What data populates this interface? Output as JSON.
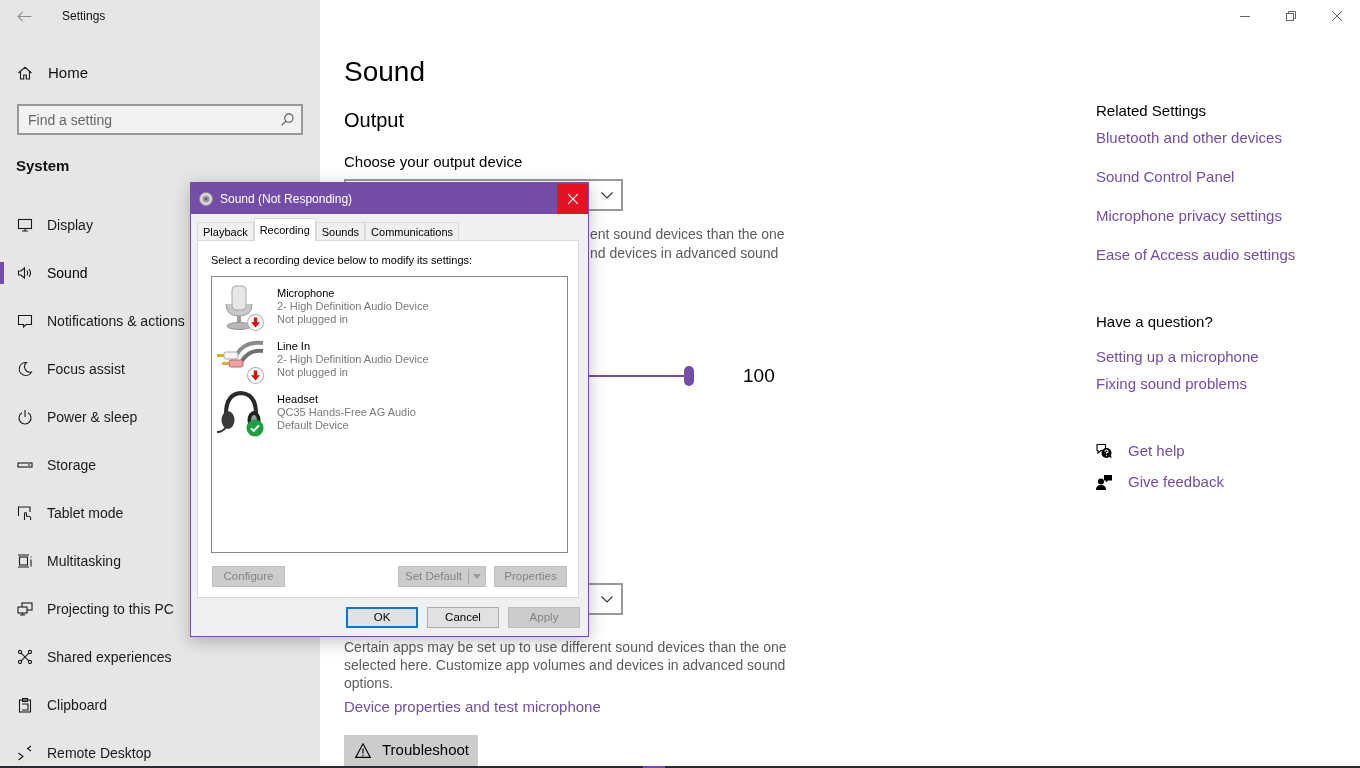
{
  "window": {
    "title": "Settings"
  },
  "sidebar": {
    "home": "Home",
    "search": {
      "placeholder": "Find a setting"
    },
    "section": "System",
    "items": [
      {
        "label": "Display",
        "selected": false
      },
      {
        "label": "Sound",
        "selected": true
      },
      {
        "label": "Notifications & actions",
        "selected": false
      },
      {
        "label": "Focus assist",
        "selected": false
      },
      {
        "label": "Power & sleep",
        "selected": false
      },
      {
        "label": "Storage",
        "selected": false
      },
      {
        "label": "Tablet mode",
        "selected": false
      },
      {
        "label": "Multitasking",
        "selected": false
      },
      {
        "label": "Projecting to this PC",
        "selected": false
      },
      {
        "label": "Shared experiences",
        "selected": false
      },
      {
        "label": "Clipboard",
        "selected": false
      },
      {
        "label": "Remote Desktop",
        "selected": false
      }
    ]
  },
  "page": {
    "title": "Sound",
    "output": {
      "heading": "Output",
      "device_label": "Choose your output device",
      "note_fragments": [
        "ent sound devices than the one",
        "nd devices in advanced sound"
      ],
      "volume": {
        "level": 1,
        "reading": "100"
      }
    },
    "input": {
      "note": "Certain apps may be set up to use different sound devices than the one selected here. Customize app volumes and devices in advanced sound options.",
      "link": "Device properties and test microphone",
      "troubleshoot": "Troubleshoot"
    }
  },
  "related_settings": {
    "heading": "Related Settings",
    "links": [
      "Bluetooth and other devices",
      "Sound Control Panel",
      "Microphone privacy settings",
      "Ease of Access audio settings"
    ]
  },
  "questions": {
    "heading": "Have a question?",
    "links": [
      "Setting up a microphone",
      "Fixing sound problems"
    ]
  },
  "support": [
    {
      "kind": "help",
      "label": "Get help"
    },
    {
      "kind": "feedback",
      "label": "Give feedback"
    }
  ],
  "dialog": {
    "title": "Sound (Not Responding)",
    "tabs": [
      {
        "label": "Playback",
        "selected": false
      },
      {
        "label": "Recording",
        "selected": true
      },
      {
        "label": "Sounds",
        "selected": false
      },
      {
        "label": "Communications",
        "selected": false
      }
    ],
    "instruction": "Select a recording device below to modify its settings:",
    "devices": [
      {
        "kind": "microphone",
        "name": "Microphone",
        "driver": "2- High Definition Audio Device",
        "status": "Not plugged in",
        "plugged_in": false,
        "default": false
      },
      {
        "kind": "line_in",
        "name": "Line In",
        "driver": "2- High Definition Audio Device",
        "status": "Not plugged in",
        "plugged_in": false,
        "default": false
      },
      {
        "kind": "headset",
        "name": "Headset",
        "driver": "QC35 Hands-Free AG Audio",
        "status": "Default Device",
        "plugged_in": true,
        "default": true
      }
    ],
    "buttons": [
      {
        "kind": "plain",
        "label": "Configure",
        "disabled": true
      },
      {
        "kind": "split",
        "label": "Set Default",
        "disabled": true
      },
      {
        "kind": "plain",
        "label": "Properties",
        "disabled": true
      }
    ],
    "footer_buttons": [
      {
        "label": "OK",
        "disabled": false,
        "focused": true
      },
      {
        "label": "Cancel",
        "disabled": false,
        "focused": false
      },
      {
        "label": "Apply",
        "disabled": true,
        "focused": false
      }
    ]
  }
}
